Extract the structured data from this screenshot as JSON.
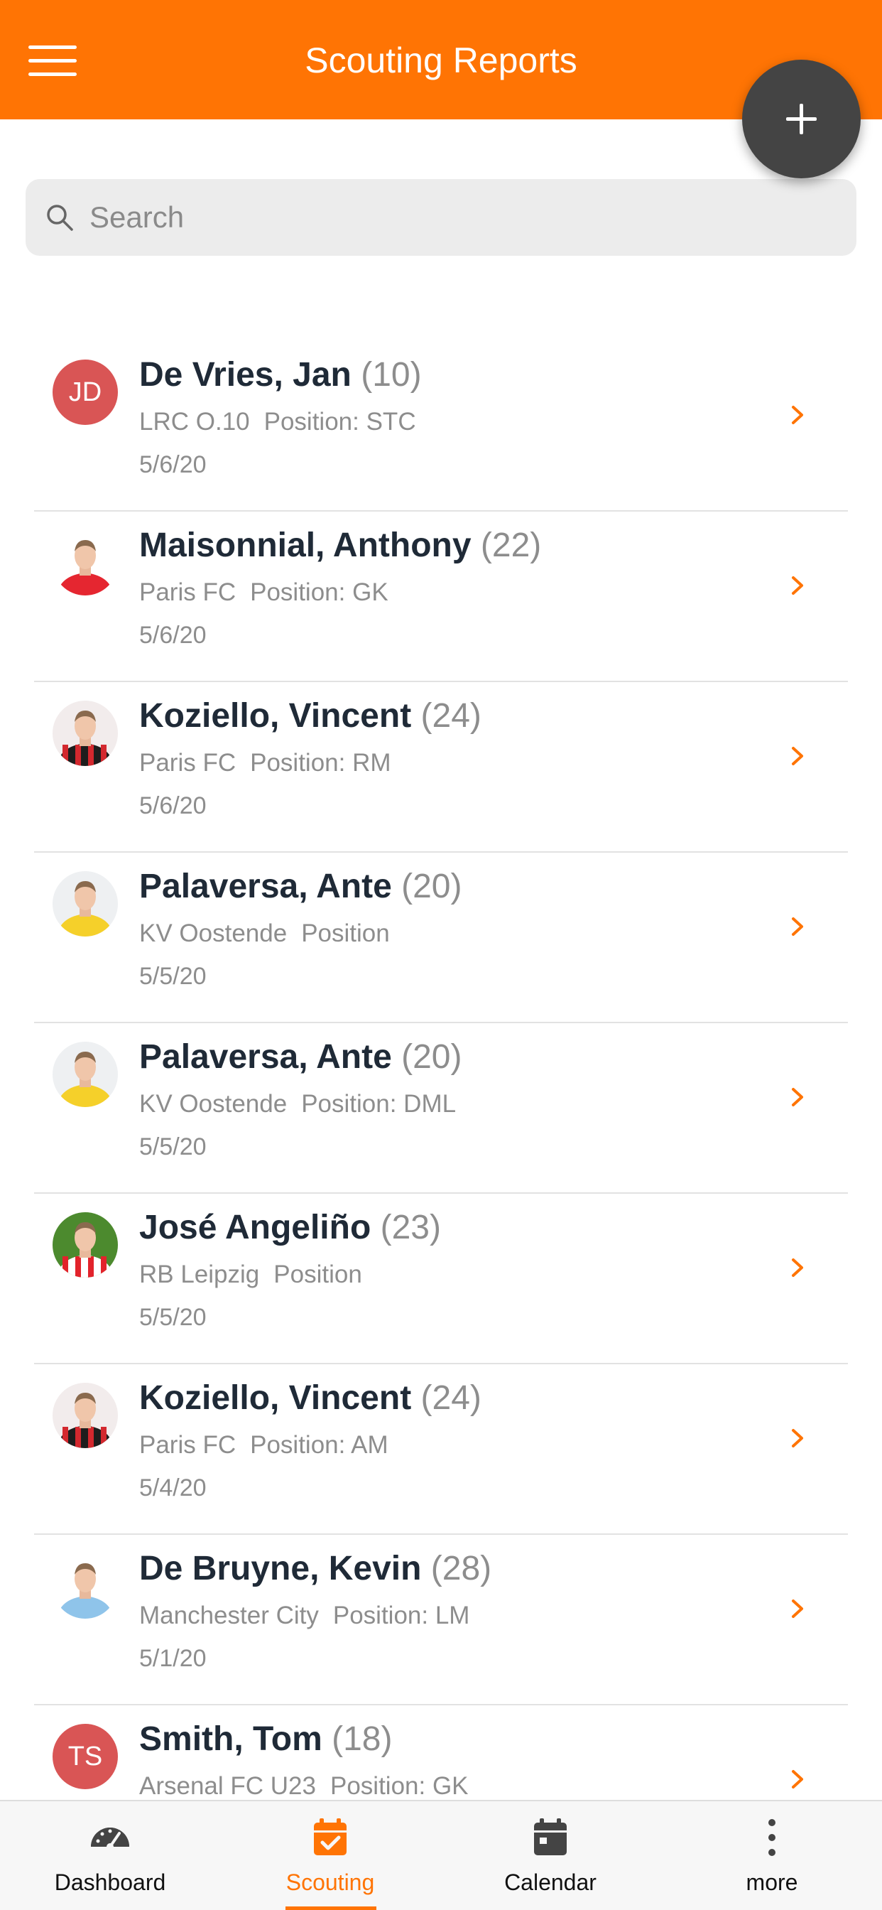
{
  "header": {
    "title": "Scouting Reports"
  },
  "colors": {
    "accent": "#ff7404",
    "fab": "#444444",
    "initials_avatar": "#d95555",
    "text_primary": "#1f2a37",
    "text_secondary": "#8d8d8d"
  },
  "search": {
    "placeholder": "Search",
    "value": ""
  },
  "reports": [
    {
      "name": "De Vries, Jan",
      "age": "(10)",
      "club": "LRC O.10",
      "position": "Position: STC",
      "date": "5/6/20",
      "avatar": {
        "type": "initials",
        "text": "JD"
      }
    },
    {
      "name": "Maisonnial, Anthony",
      "age": "(22)",
      "club": "Paris FC",
      "position": "Position: GK",
      "date": "5/6/20",
      "avatar": {
        "type": "photo",
        "icon": "player-photo-red-kit"
      }
    },
    {
      "name": "Koziello, Vincent",
      "age": "(24)",
      "club": "Paris FC",
      "position": "Position: RM",
      "date": "5/6/20",
      "avatar": {
        "type": "photo",
        "icon": "player-photo-striped-kit"
      }
    },
    {
      "name": "Palaversa, Ante",
      "age": "(20)",
      "club": "KV Oostende",
      "position": "Position",
      "date": "5/5/20",
      "avatar": {
        "type": "photo",
        "icon": "player-photo-yellow-kit"
      }
    },
    {
      "name": "Palaversa, Ante",
      "age": "(20)",
      "club": "KV Oostende",
      "position": "Position: DML",
      "date": "5/5/20",
      "avatar": {
        "type": "photo",
        "icon": "player-photo-yellow-kit"
      }
    },
    {
      "name": "José Angeliño",
      "age": "(23)",
      "club": "RB Leipzig",
      "position": "Position",
      "date": "5/5/20",
      "avatar": {
        "type": "photo",
        "icon": "player-photo-red-white-kit"
      }
    },
    {
      "name": "Koziello, Vincent",
      "age": "(24)",
      "club": "Paris FC",
      "position": "Position: AM",
      "date": "5/4/20",
      "avatar": {
        "type": "photo",
        "icon": "player-photo-striped-kit"
      }
    },
    {
      "name": "De Bruyne, Kevin",
      "age": "(28)",
      "club": "Manchester City",
      "position": "Position: LM",
      "date": "5/1/20",
      "avatar": {
        "type": "photo",
        "icon": "player-photo-sky-blue-kit"
      }
    },
    {
      "name": "Smith, Tom",
      "age": "(18)",
      "club": "Arsenal FC U23",
      "position": "Position: GK",
      "date": "",
      "avatar": {
        "type": "initials",
        "text": "TS"
      }
    }
  ],
  "tabs": [
    {
      "label": "Dashboard",
      "icon": "speedometer-icon",
      "active": false
    },
    {
      "label": "Scouting",
      "icon": "calendar-check-icon",
      "active": true
    },
    {
      "label": "Calendar",
      "icon": "calendar-icon",
      "active": false
    },
    {
      "label": "more",
      "icon": "more-vertical-icon",
      "active": false
    }
  ]
}
